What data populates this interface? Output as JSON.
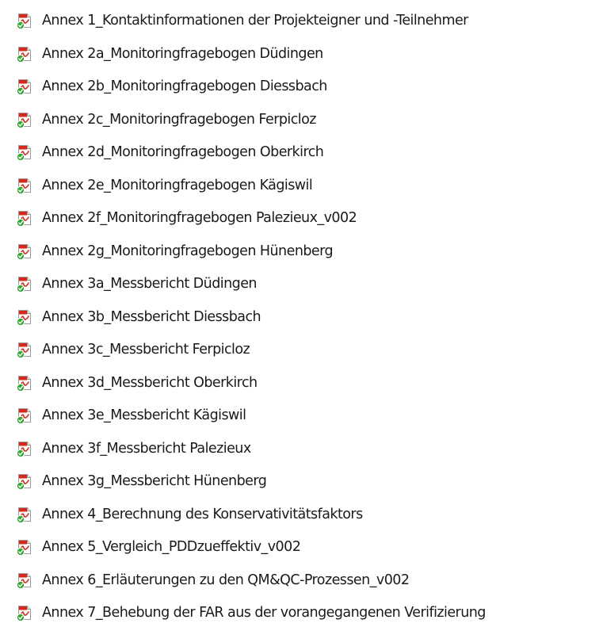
{
  "files": [
    {
      "name": "Annex 1_Kontaktinformationen der Projekteigner und -Teilnehmer",
      "icon": "pdf-file-synced-icon"
    },
    {
      "name": "Annex 2a_Monitoringfragebogen Düdingen",
      "icon": "pdf-file-synced-icon"
    },
    {
      "name": "Annex 2b_Monitoringfragebogen Diessbach",
      "icon": "pdf-file-synced-icon"
    },
    {
      "name": "Annex 2c_Monitoringfragebogen Ferpicloz",
      "icon": "pdf-file-synced-icon"
    },
    {
      "name": "Annex 2d_Monitoringfragebogen Oberkirch",
      "icon": "pdf-file-synced-icon"
    },
    {
      "name": "Annex 2e_Monitoringfragebogen Kägiswil",
      "icon": "pdf-file-synced-icon"
    },
    {
      "name": "Annex 2f_Monitoringfragebogen Palezieux_v002",
      "icon": "pdf-file-synced-icon"
    },
    {
      "name": "Annex 2g_Monitoringfragebogen Hünenberg",
      "icon": "pdf-file-synced-icon"
    },
    {
      "name": "Annex 3a_Messbericht Düdingen",
      "icon": "pdf-file-synced-icon"
    },
    {
      "name": "Annex 3b_Messbericht Diessbach",
      "icon": "pdf-file-synced-icon"
    },
    {
      "name": "Annex 3c_Messbericht Ferpicloz",
      "icon": "pdf-file-synced-icon"
    },
    {
      "name": "Annex 3d_Messbericht Oberkirch",
      "icon": "pdf-file-synced-icon"
    },
    {
      "name": "Annex 3e_Messbericht Kägiswil",
      "icon": "pdf-file-synced-icon"
    },
    {
      "name": "Annex 3f_Messbericht Palezieux",
      "icon": "pdf-file-synced-icon"
    },
    {
      "name": "Annex 3g_Messbericht Hünenberg",
      "icon": "pdf-file-synced-icon"
    },
    {
      "name": "Annex 4_Berechnung des Konservativitätsfaktors",
      "icon": "pdf-file-synced-icon"
    },
    {
      "name": "Annex 5_Vergleich_PDDzueffektiv_v002",
      "icon": "pdf-file-synced-icon"
    },
    {
      "name": "Annex 6_Erläuterungen zu den QM&QC-Prozessen_v002",
      "icon": "pdf-file-synced-icon"
    },
    {
      "name": "Annex 7_Behebung der FAR aus der vorangegangenen Verifizierung",
      "icon": "pdf-file-synced-icon"
    }
  ],
  "colors": {
    "text": "#1a1a1a",
    "pdf_red": "#d42a1e",
    "sync_green": "#2fa52f"
  }
}
